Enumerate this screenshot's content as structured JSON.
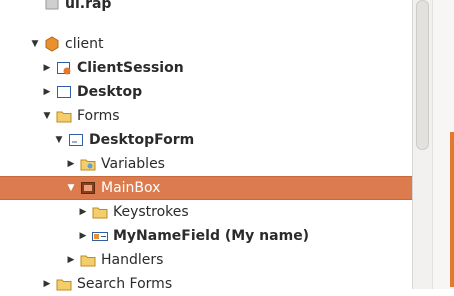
{
  "tree": {
    "items": [
      {
        "label": "ui.rap",
        "bold": true,
        "icon": "project-icon",
        "expanded": null
      },
      {
        "label": "client",
        "bold": false,
        "icon": "bundle-icon",
        "expanded": true
      },
      {
        "label": "ClientSession",
        "bold": true,
        "icon": "session-icon",
        "expanded": false
      },
      {
        "label": "Desktop",
        "bold": true,
        "icon": "desktop-icon",
        "expanded": false
      },
      {
        "label": "Forms",
        "bold": false,
        "icon": "folder-icon",
        "expanded": true
      },
      {
        "label": "DesktopForm",
        "bold": true,
        "icon": "form-icon",
        "expanded": true
      },
      {
        "label": "Variables",
        "bold": false,
        "icon": "folder-icon",
        "expanded": false
      },
      {
        "label": "MainBox",
        "bold": false,
        "icon": "groupbox-icon",
        "expanded": true,
        "selected": true
      },
      {
        "label": "Keystrokes",
        "bold": false,
        "icon": "folder-icon",
        "expanded": false
      },
      {
        "label": "MyNameField (My name)",
        "bold": true,
        "icon": "stringfield-icon",
        "expanded": false
      },
      {
        "label": "Handlers",
        "bold": false,
        "icon": "folder-icon",
        "expanded": false
      },
      {
        "label": "Search Forms",
        "bold": false,
        "icon": "folder-icon",
        "expanded": false
      }
    ]
  },
  "colors": {
    "selection": "#dc7b4d",
    "folder": "#e8b54a",
    "accent": "#e2792f"
  }
}
